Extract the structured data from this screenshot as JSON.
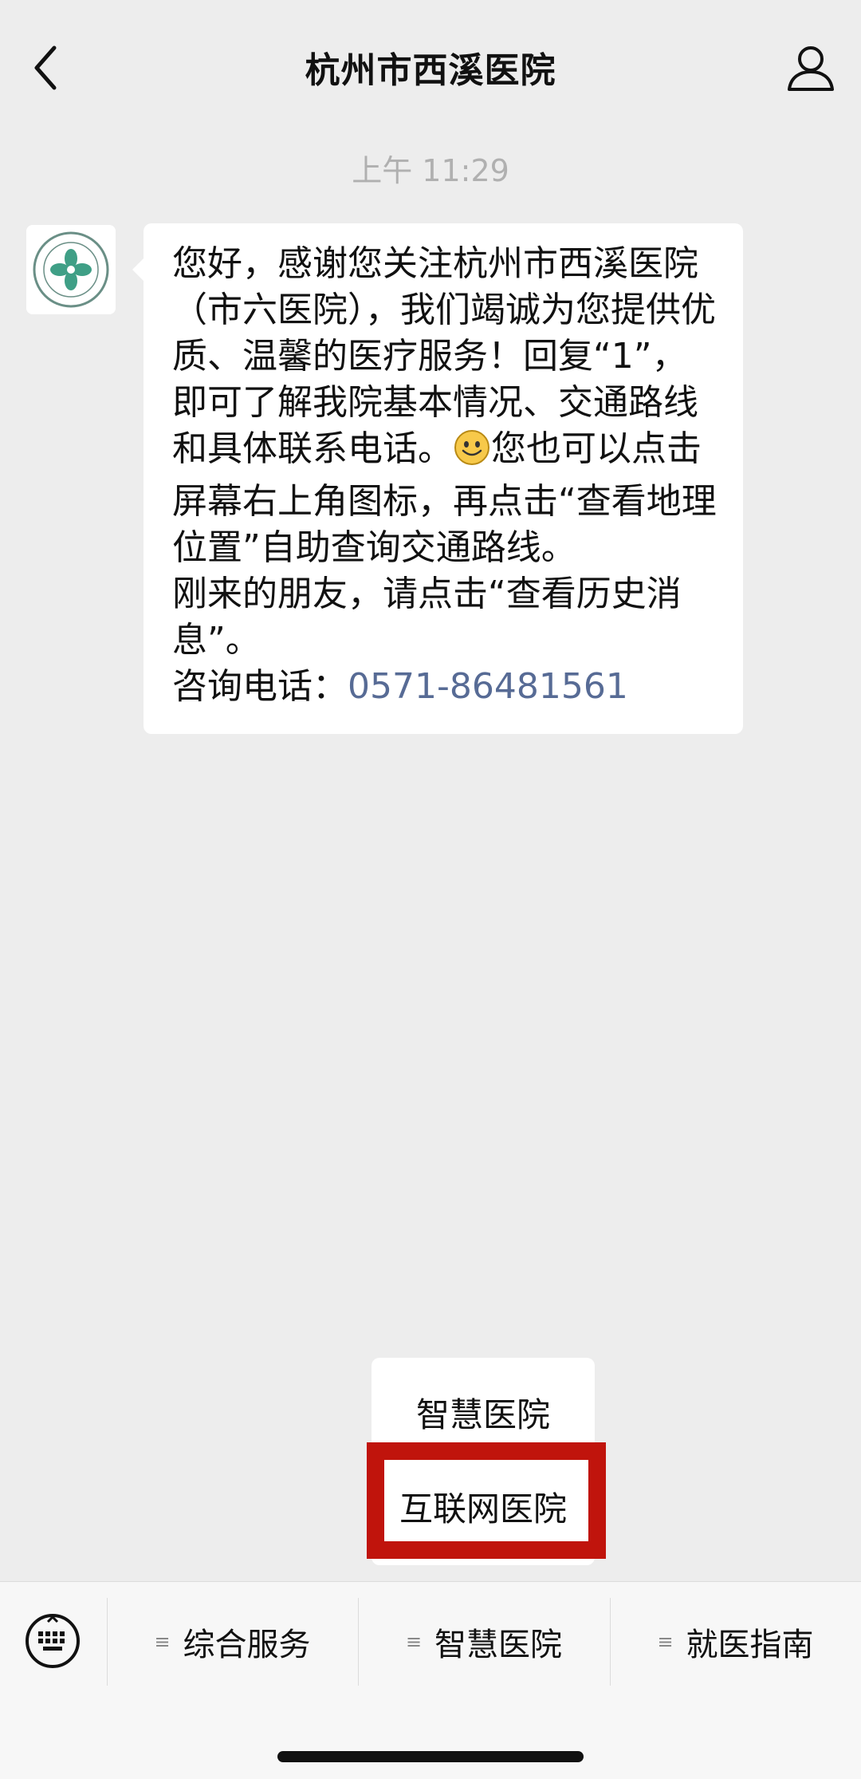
{
  "navbar": {
    "title": "杭州市西溪医院",
    "back_icon": "chevron-left-icon",
    "profile_icon": "person-icon"
  },
  "chat": {
    "timestamp": "上午 11:29",
    "message": {
      "part1": "您好，感谢您关注杭州市西溪医院（市六医院），我们竭诚为您提供优质、温馨的医疗服务！回复“1”，即可了解我院基本情况、交通路线和具体联系电话。",
      "emoji": "smile-emoji",
      "part2": "您也可以点击屏幕右上角图标，再点击“查看地理位置”自助查询交通路线。\n刚来的朋友，请点击“查看历史消息”。\n咨询电话：",
      "phone": "0571-86481561"
    },
    "avatar_logo": "hospital-logo"
  },
  "submenu": {
    "items": [
      "智慧医院",
      "互联网医院"
    ],
    "highlight_color": "#c0140c"
  },
  "bottom_menu": {
    "tabs": [
      {
        "label": "综合服务"
      },
      {
        "label": "智慧医院"
      },
      {
        "label": "就医指南"
      }
    ],
    "tab_icon": "≡",
    "keyboard_icon": "keyboard-icon"
  },
  "colors": {
    "background": "#ededed",
    "bubble": "#ffffff",
    "link": "#576b95"
  }
}
